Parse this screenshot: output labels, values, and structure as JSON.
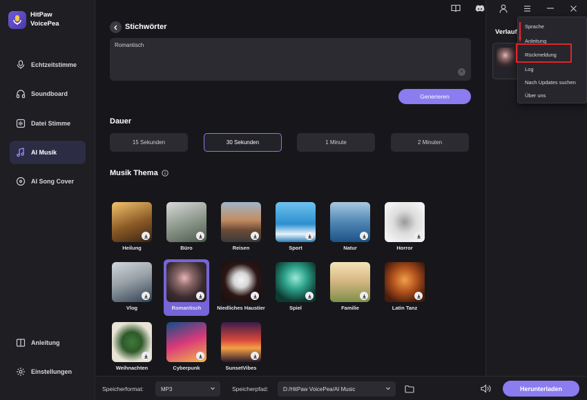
{
  "app": {
    "name_line1": "HitPaw",
    "name_line2": "VoicePea"
  },
  "sidebar": {
    "items": [
      {
        "label": "Echtzeitstimme",
        "icon": "microphone-icon"
      },
      {
        "label": "Soundboard",
        "icon": "headphones-icon"
      },
      {
        "label": "Datei Stimme",
        "icon": "file-audio-icon"
      },
      {
        "label": "AI Musik",
        "icon": "music-note-icon",
        "active": true
      },
      {
        "label": "AI Song Cover",
        "icon": "vinyl-icon"
      }
    ],
    "bottom": [
      {
        "label": "Anleitung",
        "icon": "book-icon"
      },
      {
        "label": "Einstellungen",
        "icon": "gear-icon"
      }
    ]
  },
  "main": {
    "title": "Stichwörter",
    "prompt_value": "Romantisch",
    "generate_label": "Generieren",
    "duration_title": "Dauer",
    "durations": [
      "15 Sekunden",
      "30 Sekunden",
      "1 Minute",
      "2 Minuten"
    ],
    "selected_duration": "30 Sekunden",
    "theme_title": "Musik Thema",
    "themes": [
      {
        "label": "Heilung"
      },
      {
        "label": "Büro"
      },
      {
        "label": "Reisen"
      },
      {
        "label": "Sport"
      },
      {
        "label": "Natur"
      },
      {
        "label": "Horror"
      },
      {
        "label": "Vlog"
      },
      {
        "label": "Romantisch",
        "selected": true
      },
      {
        "label": "Niedliches Haustier"
      },
      {
        "label": "Spiel"
      },
      {
        "label": "Familie"
      },
      {
        "label": "Latin Tanz"
      },
      {
        "label": "Weihnachten"
      },
      {
        "label": "Cyberpunk"
      },
      {
        "label": "SunsetVibes"
      }
    ]
  },
  "bottom_bar": {
    "format_label": "Speicherformat:",
    "format_value": "MP3",
    "path_label": "Speicherpfad:",
    "path_value": "D:/HitPaw VoicePea/AI Music",
    "download_label": "Herunterladen"
  },
  "right_panel": {
    "history_title": "Verlauf"
  },
  "menu": {
    "items": [
      "Sprache",
      "Anleitung",
      "Rückmeldung",
      "Log",
      "Nach Updates suchen",
      "Über uns"
    ],
    "highlighted": "Rückmeldung"
  },
  "colors": {
    "accent": "#8b7cf0",
    "highlight": "#e0262a",
    "background": "#17171b"
  }
}
